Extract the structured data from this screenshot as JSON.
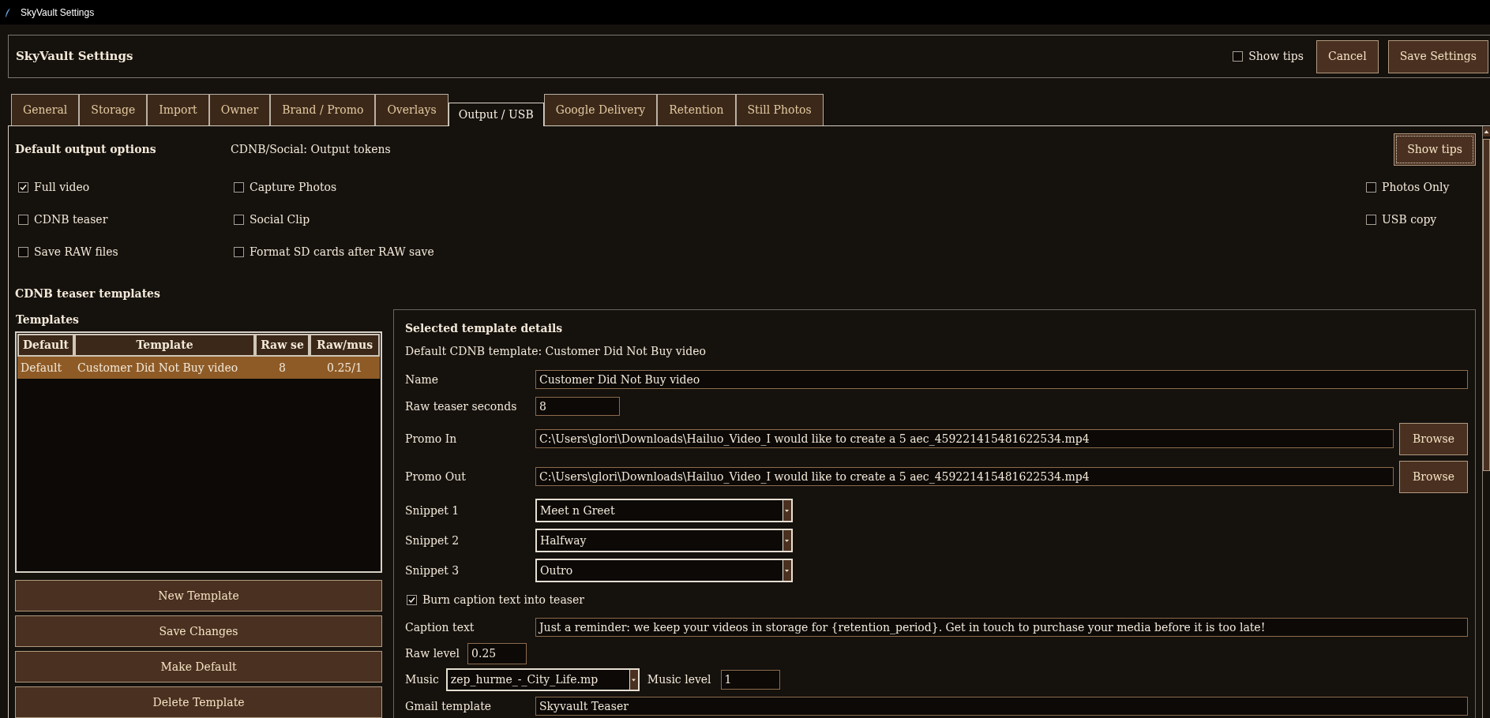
{
  "window": {
    "title": "SkyVault Settings"
  },
  "header": {
    "title": "SkyVault Settings",
    "show_tips": {
      "label": "Show tips",
      "checked": false
    },
    "buttons": [
      "Cancel",
      "Save Settings"
    ]
  },
  "tabs": [
    {
      "label": "General",
      "selected": false
    },
    {
      "label": "Storage",
      "selected": false
    },
    {
      "label": "Import",
      "selected": false
    },
    {
      "label": "Owner",
      "selected": false
    },
    {
      "label": "Brand / Promo",
      "selected": false
    },
    {
      "label": "Overlays",
      "selected": false
    },
    {
      "label": "Output / USB",
      "selected": true
    },
    {
      "label": "Google Delivery",
      "selected": false
    },
    {
      "label": "Retention",
      "selected": false
    },
    {
      "label": "Still Photos",
      "selected": false
    }
  ],
  "output_options": {
    "title": "Default output options",
    "tokens_label": "CDNB/Social: Output tokens",
    "tips_button": "Show tips",
    "columns": [
      {
        "options": [
          {
            "label": "Full video",
            "checked": true
          },
          {
            "label": "CDNB teaser",
            "checked": false
          },
          {
            "label": "Save RAW files",
            "checked": false
          }
        ]
      },
      {
        "options": [
          {
            "label": "Capture Photos",
            "checked": false
          },
          {
            "label": "Social Clip",
            "checked": false
          },
          {
            "label": "Format SD cards after RAW save",
            "checked": false
          }
        ]
      },
      {
        "options": [
          {
            "label": "Photos Only",
            "checked": false
          },
          {
            "label": "USB copy",
            "checked": false
          }
        ]
      }
    ]
  },
  "templates": {
    "title": "CDNB teaser templates",
    "list_title": "Templates",
    "table": {
      "columns": [
        "Default",
        "Template",
        "Raw se",
        "Raw/mus"
      ],
      "rows": [
        {
          "cells": [
            "Default",
            "Customer Did Not Buy video",
            "8",
            "0.25/1"
          ],
          "selected": true
        }
      ]
    },
    "buttons": [
      "New Template",
      "Save Changes",
      "Make Default",
      "Delete Template"
    ]
  },
  "details": {
    "title": "Selected template details",
    "default_note": "Default CDNB template: Customer Did Not Buy video",
    "rows": [
      {
        "kind": "text",
        "label": "Name",
        "value": "Customer Did Not Buy video"
      },
      {
        "kind": "short",
        "label": "Raw teaser seconds",
        "value": "8"
      },
      {
        "kind": "file",
        "label": "Promo In",
        "value": "C:\\Users\\glori\\Downloads\\Hailuo_Video_I would like to create a 5 aec_459221415481622534.mp4",
        "button": "Browse"
      },
      {
        "kind": "file",
        "label": "Promo Out",
        "value": "C:\\Users\\glori\\Downloads\\Hailuo_Video_I would like to create a 5 aec_459221415481622534.mp4",
        "button": "Browse"
      },
      {
        "kind": "select",
        "label": "Snippet 1",
        "value": "Meet n Greet"
      },
      {
        "kind": "select",
        "label": "Snippet 2",
        "value": "Halfway"
      },
      {
        "kind": "select",
        "label": "Snippet 3",
        "value": "Outro"
      },
      {
        "kind": "checkbox",
        "label": "Burn caption text into teaser",
        "checked": true
      },
      {
        "kind": "text",
        "label": "Caption text",
        "value": "Just a reminder: we keep your videos in storage for {retention_period}. Get in touch to purchase your media before it is too late!"
      },
      {
        "kind": "inline",
        "label": "Raw level",
        "value": "0.25"
      },
      {
        "kind": "music",
        "label": "Music",
        "value": "zep_hurme_-_City_Life.mp",
        "level_label": "Music level",
        "level_value": "1"
      },
      {
        "kind": "text",
        "label": "Gmail template",
        "value": "Skyvault Teaser"
      }
    ]
  }
}
